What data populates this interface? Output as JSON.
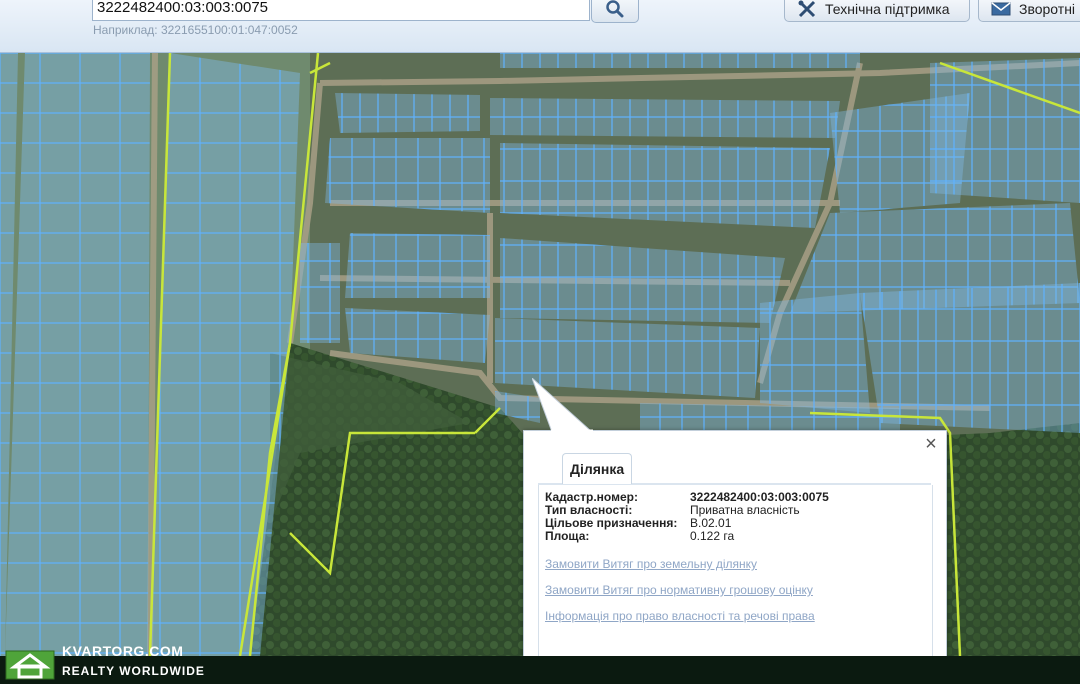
{
  "search": {
    "value": "3222482400:03:003:0075",
    "hint": "Наприклад: 3221655100:01:047:0052"
  },
  "toolbar": {
    "support_label": "Технічна підтримка",
    "feedback_label": "Зворотні"
  },
  "popup": {
    "tab_label": "Ділянка",
    "fields": [
      {
        "label": "Кадастр.номер:",
        "value": "3222482400:03:003:0075"
      },
      {
        "label": "Тип власності:",
        "value": "Приватна власність"
      },
      {
        "label": "Цільове призначення:",
        "value": "В.02.01"
      },
      {
        "label": "Площа:",
        "value": "0.122 га"
      }
    ],
    "links": [
      "Замовити Витяг про земельну ділянку",
      "Замовити Витяг про нормативну грошову оцінку",
      "Інформація про право власності та речові права"
    ],
    "close_symbol": "×"
  },
  "watermark": {
    "title": "KVARTORG.COM",
    "subtitle": "REALTY WORLDWIDE"
  },
  "colors": {
    "parcel_fill": "#7fb8e6",
    "parcel_stroke": "#5fb2ff",
    "boundary": "#c8e63a",
    "link": "#8fa6c6"
  },
  "icons": {
    "search": "search-icon",
    "support": "tools-icon",
    "feedback": "envelope-icon",
    "close": "close-icon",
    "logo": "house-icon"
  }
}
